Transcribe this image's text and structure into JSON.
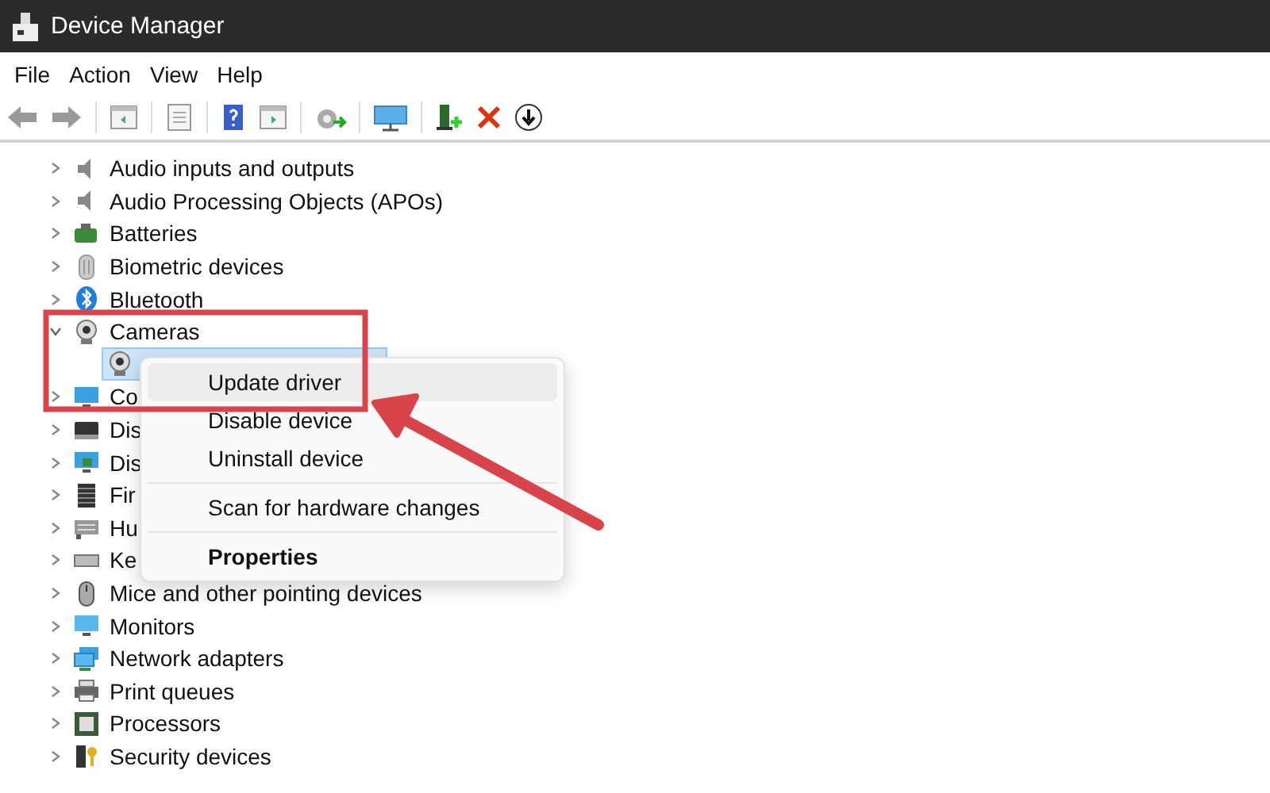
{
  "window": {
    "title": "Device Manager"
  },
  "menu_bar": [
    "File",
    "Action",
    "View",
    "Help"
  ],
  "tree": [
    {
      "label": "Audio inputs and outputs",
      "expanded": false
    },
    {
      "label": "Audio Processing Objects (APOs)",
      "expanded": false
    },
    {
      "label": "Batteries",
      "expanded": false
    },
    {
      "label": "Biometric devices",
      "expanded": false
    },
    {
      "label": "Bluetooth",
      "expanded": false
    },
    {
      "label": "Cameras",
      "expanded": true,
      "children": [
        {
          "selected": true
        }
      ]
    },
    {
      "label": "Co",
      "expanded": false
    },
    {
      "label": "Dis",
      "expanded": false
    },
    {
      "label": "Dis",
      "expanded": false
    },
    {
      "label": "Fir",
      "expanded": false
    },
    {
      "label": "Hu",
      "expanded": false
    },
    {
      "label": "Ke",
      "expanded": false
    },
    {
      "label": "Mice and other pointing devices",
      "expanded": false
    },
    {
      "label": "Monitors",
      "expanded": false
    },
    {
      "label": "Network adapters",
      "expanded": false
    },
    {
      "label": "Print queues",
      "expanded": false
    },
    {
      "label": "Processors",
      "expanded": false
    },
    {
      "label": "Security devices",
      "expanded": false
    }
  ],
  "context_menu": [
    {
      "label": "Update driver",
      "kind": "item",
      "selected": true
    },
    {
      "label": "Disable device",
      "kind": "item",
      "selected": false
    },
    {
      "label": "Uninstall device",
      "kind": "item",
      "selected": false
    },
    {
      "kind": "separator"
    },
    {
      "label": "Scan for hardware changes",
      "kind": "item",
      "selected": false
    },
    {
      "kind": "separator"
    },
    {
      "label": "Properties",
      "kind": "default",
      "selected": false
    }
  ],
  "annotation": {
    "highlight_box": true,
    "arrow": true
  }
}
